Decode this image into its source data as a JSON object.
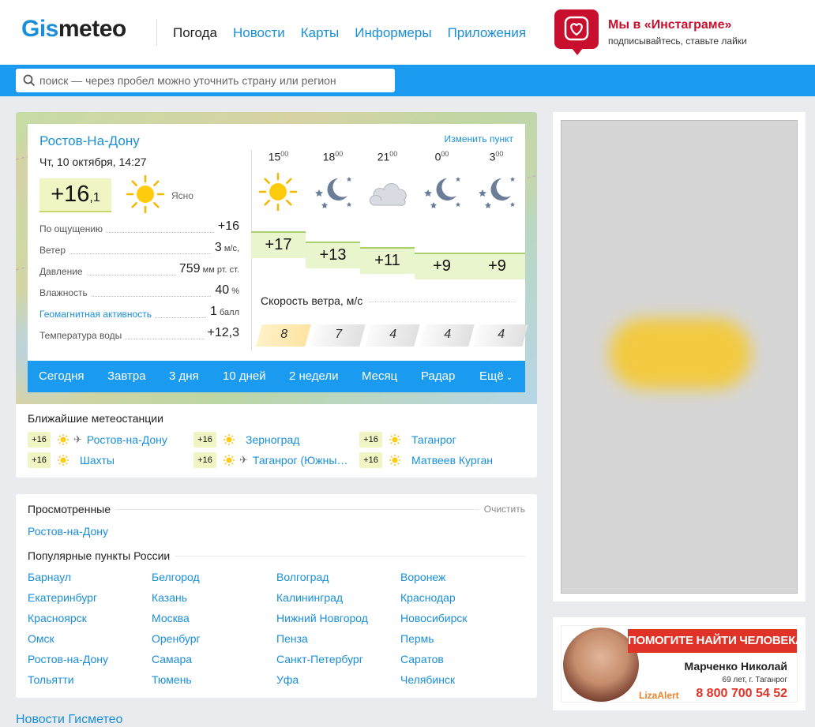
{
  "header": {
    "logo_gis": "Gis",
    "logo_meteo": "meteo",
    "nav": [
      "Погода",
      "Новости",
      "Карты",
      "Информеры",
      "Приложения"
    ],
    "promo_title": "Мы в «Инстаграме»",
    "promo_subtitle": "подписывайтесь, ставьте лайки"
  },
  "search": {
    "placeholder": "поиск — через пробел можно уточнить страну или регион"
  },
  "weather": {
    "city": "Ростов-На-Дону",
    "change_link": "Изменить пункт",
    "datetime": "Чт, 10 октября, 14:27",
    "now_temp_int": "+16",
    "now_temp_frac": ",1",
    "condition": "Ясно",
    "params": [
      {
        "label": "По ощущению",
        "value": "+16",
        "unit": ""
      },
      {
        "label": "Ветер",
        "value": "3",
        "unit": " м/с,"
      },
      {
        "label": "Давление",
        "value": "759",
        "unit": " мм рт. ст."
      },
      {
        "label": "Влажность",
        "value": "40",
        "unit": " %"
      },
      {
        "label": "Геомагнитная активность",
        "value": "1",
        "unit": " балл"
      },
      {
        "label": "Температура воды",
        "value": "+12,3",
        "unit": ""
      }
    ],
    "hours": [
      {
        "h": "15",
        "m": "00",
        "icon": "sun-icon",
        "temp": "+17",
        "wind": "8"
      },
      {
        "h": "18",
        "m": "00",
        "icon": "moon-stars-icon",
        "temp": "+13",
        "wind": "7"
      },
      {
        "h": "21",
        "m": "00",
        "icon": "cloud-icon",
        "temp": "+11",
        "wind": "4"
      },
      {
        "h": "0",
        "m": "00",
        "icon": "moon-stars-icon",
        "temp": "+9",
        "wind": "4"
      },
      {
        "h": "3",
        "m": "00",
        "icon": "moon-stars-icon",
        "temp": "+9",
        "wind": "4"
      }
    ],
    "wind_title": "Скорость ветра, м/с",
    "tabs": [
      "Сегодня",
      "Завтра",
      "3 дня",
      "10 дней",
      "2 недели",
      "Месяц",
      "Радар",
      "Ещё"
    ],
    "stations_title": "Ближайшие метеостанции",
    "stations": [
      {
        "temp": "+16",
        "name": "Ростов-на-Дону",
        "airport": true
      },
      {
        "temp": "+16",
        "name": "Зерноград",
        "airport": false
      },
      {
        "temp": "+16",
        "name": "Таганрог",
        "airport": false
      },
      {
        "temp": "+16",
        "name": "Шахты",
        "airport": false
      },
      {
        "temp": "+16",
        "name": "Таганрог (Южны…",
        "airport": true
      },
      {
        "temp": "+16",
        "name": "Матвеев Курган",
        "airport": false
      }
    ]
  },
  "viewed": {
    "title": "Просмотренные",
    "clear": "Очистить",
    "items": [
      "Ростов-на-Дону"
    ],
    "popular_title": "Популярные пункты России",
    "popular": [
      [
        "Барнаул",
        "Белгород",
        "Волгоград",
        "Воронеж"
      ],
      [
        "Екатеринбург",
        "Казань",
        "Калининград",
        "Краснодар"
      ],
      [
        "Красноярск",
        "Москва",
        "Нижний Новгород",
        "Новосибирск"
      ],
      [
        "Омск",
        "Оренбург",
        "Пенза",
        "Пермь"
      ],
      [
        "Ростов-на-Дону",
        "Самара",
        "Санкт-Петербург",
        "Саратов"
      ],
      [
        "Тольятти",
        "Тюмень",
        "Уфа",
        "Челябинск"
      ]
    ]
  },
  "news_title": "Новости Гисметео",
  "lizaalert": {
    "banner": "ПОМОГИТЕ НАЙТИ ЧЕЛОВЕКА",
    "name": "Марченко Николай",
    "age": "69 лет, г. Таганрог",
    "brand": "LizaAlert",
    "phone": "8 800 700 54 52"
  }
}
